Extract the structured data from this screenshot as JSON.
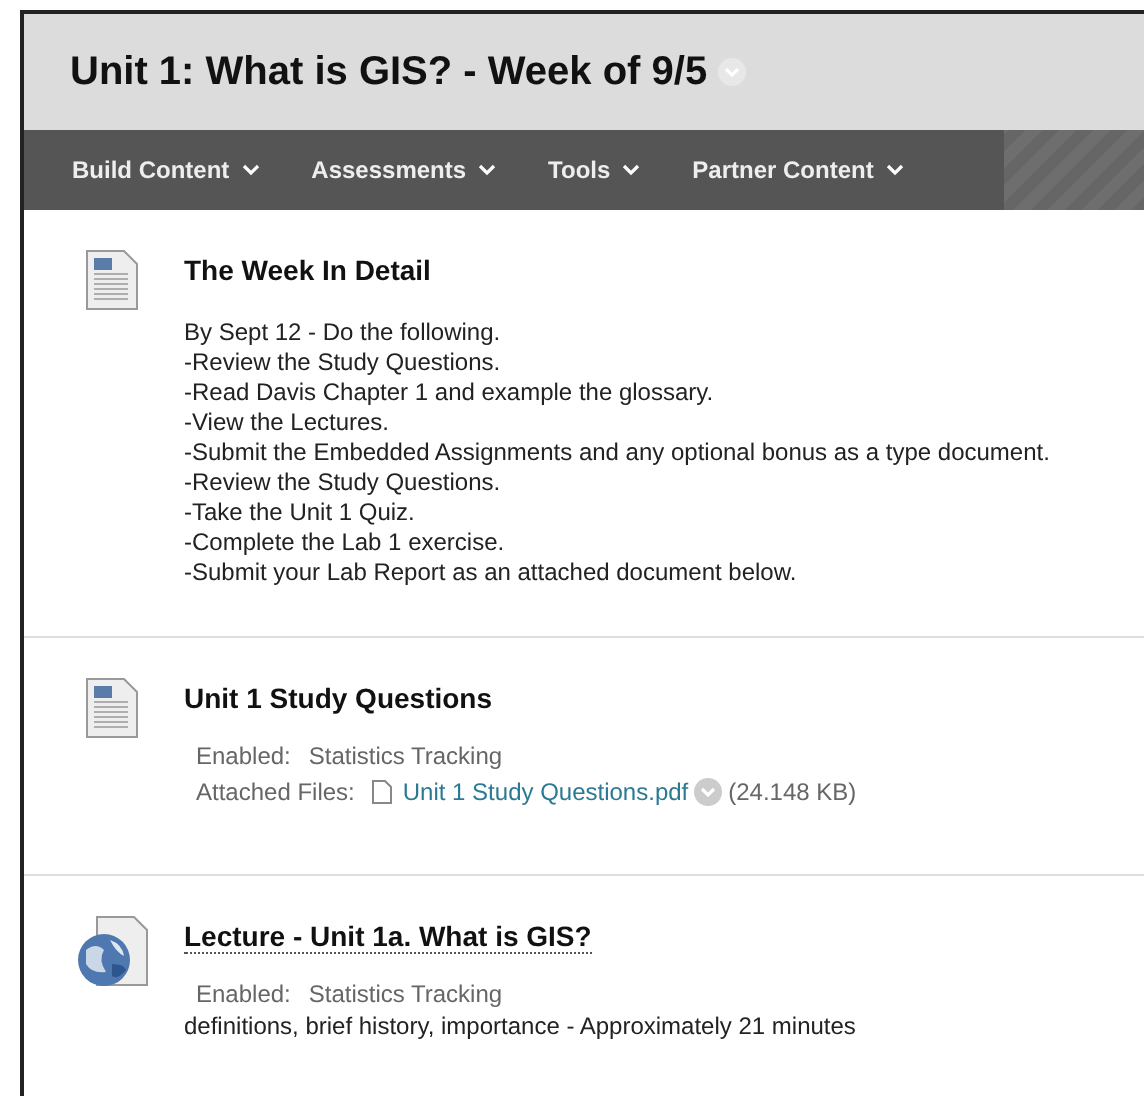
{
  "page": {
    "title": "Unit 1: What is GIS? - Week of 9/5"
  },
  "menu": [
    {
      "label": "Build Content"
    },
    {
      "label": "Assessments"
    },
    {
      "label": "Tools"
    },
    {
      "label": "Partner Content"
    }
  ],
  "items": [
    {
      "kind": "document",
      "title": "The Week In Detail",
      "linked": false,
      "lines": [
        "By Sept 12 - Do the following.",
        "-Review the Study Questions.",
        "-Read Davis Chapter 1 and example the glossary.",
        "-View the Lectures.",
        "-Submit the Embedded Assignments and any optional bonus as a type document.",
        "-Review the Study Questions.",
        "-Take the Unit 1 Quiz.",
        "-Complete the Lab 1 exercise.",
        "-Submit your Lab Report as an attached document below."
      ]
    },
    {
      "kind": "document",
      "title": "Unit 1 Study Questions",
      "linked": false,
      "details": [
        {
          "label": "Enabled:",
          "value": "Statistics Tracking"
        }
      ],
      "attachment": {
        "label": "Attached Files:",
        "file": "Unit 1 Study Questions.pdf",
        "size": "(24.148 KB)"
      }
    },
    {
      "kind": "globe",
      "title": "Lecture - Unit 1a. What is GIS?",
      "linked": true,
      "details": [
        {
          "label": "Enabled:",
          "value": "Statistics Tracking"
        }
      ],
      "lines": [
        "definitions, brief history, importance - Approximately 21 minutes"
      ]
    }
  ]
}
